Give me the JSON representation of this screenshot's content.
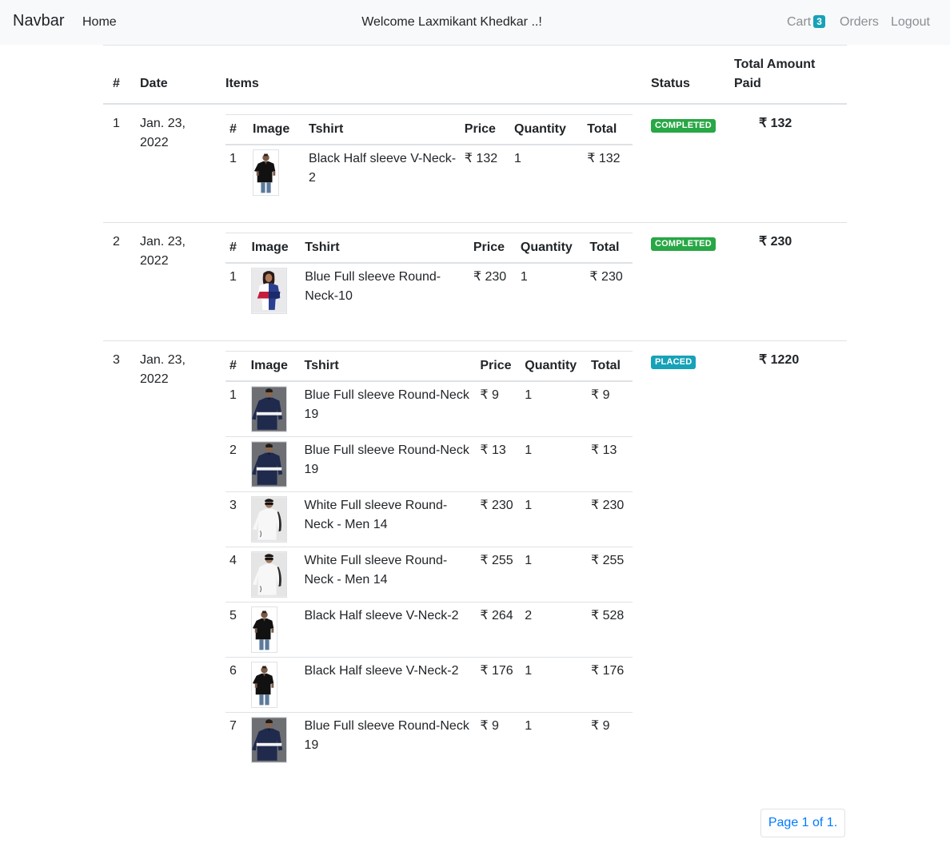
{
  "navbar": {
    "brand": "Navbar",
    "home": "Home",
    "welcome": "Welcome Laxmikant Khedkar ..!",
    "cart_label": "Cart",
    "cart_count": "3",
    "orders": "Orders",
    "logout": "Logout"
  },
  "table": {
    "headers": [
      "#",
      "Date",
      "Items",
      "Status",
      "Total Amount Paid"
    ],
    "item_headers": [
      "#",
      "Image",
      "Tshirt",
      "Price",
      "Quantity",
      "Total"
    ]
  },
  "orders": [
    {
      "no": "1",
      "date": "Jan. 23, 2022",
      "status": "COMPLETED",
      "status_color": "#28a745",
      "amount": "₹ 132",
      "items": [
        {
          "no": "1",
          "image": "black-tshirt-image",
          "name": "Black Half sleeve V-Neck-2",
          "price": "₹ 132",
          "qty": "1",
          "total": "₹ 132"
        }
      ]
    },
    {
      "no": "2",
      "date": "Jan. 23, 2022",
      "status": "COMPLETED",
      "status_color": "#28a745",
      "amount": "₹ 230",
      "items": [
        {
          "no": "1",
          "image": "blue-red-tshirt-image",
          "name": "Blue Full sleeve Round-Neck-10",
          "price": "₹ 230",
          "qty": "1",
          "total": "₹ 230"
        }
      ]
    },
    {
      "no": "3",
      "date": "Jan. 23, 2022",
      "status": "PLACED",
      "status_color": "#17a2b8",
      "amount": "₹ 1220",
      "items": [
        {
          "no": "1",
          "image": "navy-striped-tshirt-image",
          "name": "Blue Full sleeve Round-Neck 19",
          "price": "₹ 9",
          "qty": "1",
          "total": "₹ 9"
        },
        {
          "no": "2",
          "image": "navy-striped-tshirt-image",
          "name": "Blue Full sleeve Round-Neck 19",
          "price": "₹ 13",
          "qty": "1",
          "total": "₹ 13"
        },
        {
          "no": "3",
          "image": "white-tshirt-image",
          "name": "White Full sleeve Round-Neck - Men 14",
          "price": "₹ 230",
          "qty": "1",
          "total": "₹ 230"
        },
        {
          "no": "4",
          "image": "white-tshirt-image",
          "name": "White Full sleeve Round-Neck - Men 14",
          "price": "₹ 255",
          "qty": "1",
          "total": "₹ 255"
        },
        {
          "no": "5",
          "image": "black-tshirt-image",
          "name": "Black Half sleeve V-Neck-2",
          "price": "₹ 264",
          "qty": "2",
          "total": "₹ 528"
        },
        {
          "no": "6",
          "image": "black-tshirt-image",
          "name": "Black Half sleeve V-Neck-2",
          "price": "₹ 176",
          "qty": "1",
          "total": "₹ 176"
        },
        {
          "no": "7",
          "image": "navy-striped-tshirt-image",
          "name": "Blue Full sleeve Round-Neck 19",
          "price": "₹ 9",
          "qty": "1",
          "total": "₹ 9"
        }
      ]
    }
  ],
  "pagination": {
    "label": "Page 1 of 1."
  }
}
